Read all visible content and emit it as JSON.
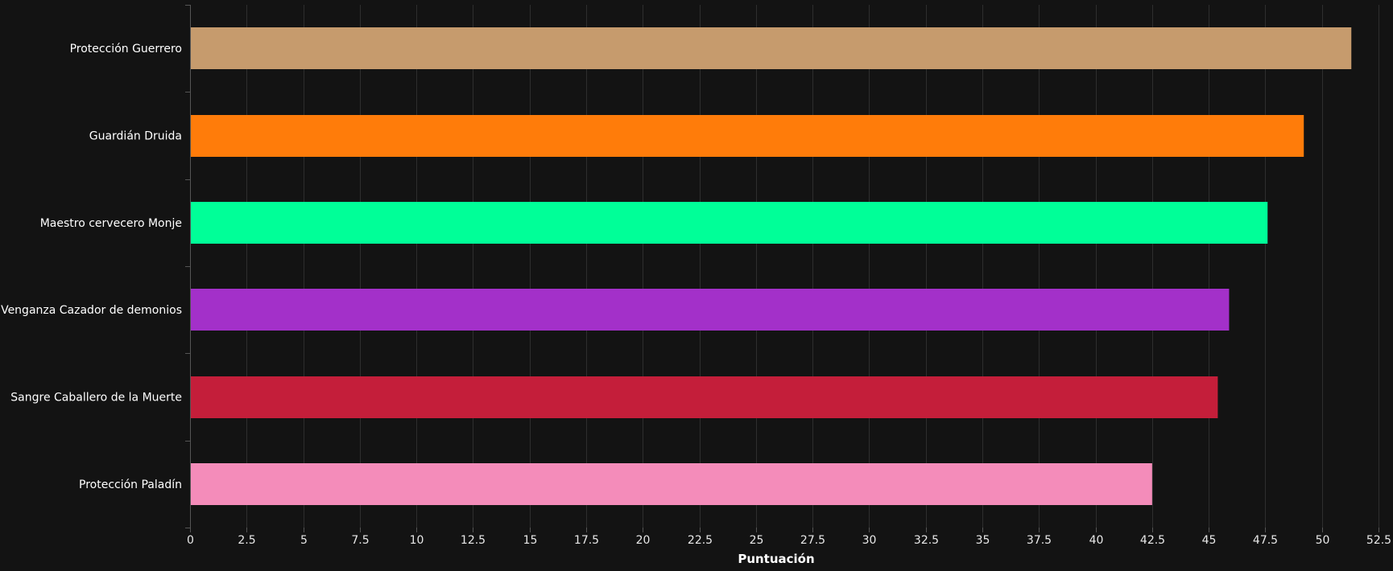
{
  "chart_data": {
    "type": "bar",
    "orientation": "horizontal",
    "categories": [
      "Protección Guerrero",
      "Guardián Druida",
      "Maestro cervecero Monje",
      "Venganza Cazador de demonios",
      "Sangre Caballero de la Muerte",
      "Protección Paladín"
    ],
    "values": [
      51.3,
      49.2,
      47.6,
      45.9,
      45.4,
      42.5
    ],
    "colors": [
      "#C69B6D",
      "#FF7C0A",
      "#00FF98",
      "#A330C9",
      "#C41E3A",
      "#F48CBA"
    ],
    "xlabel": "Puntuación",
    "ylabel": "",
    "xlim": [
      0,
      52.5
    ],
    "xticks": [
      0,
      2.5,
      5,
      7.5,
      10,
      12.5,
      15,
      17.5,
      20,
      22.5,
      25,
      27.5,
      30,
      32.5,
      35,
      37.5,
      40,
      42.5,
      45,
      47.5,
      50,
      52.5
    ],
    "grid": true,
    "background": "#131313"
  }
}
